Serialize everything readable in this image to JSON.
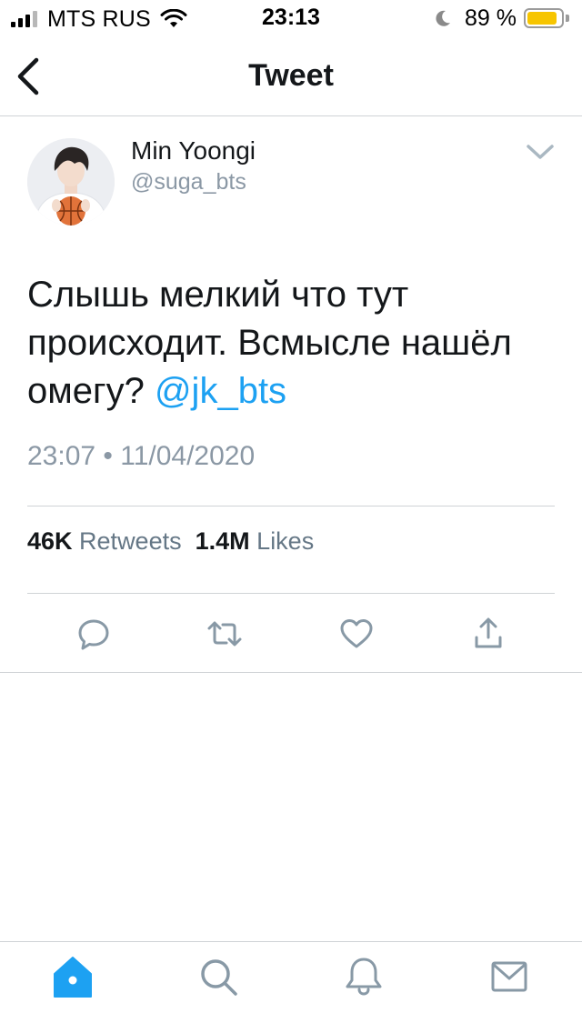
{
  "status_bar": {
    "carrier": "MTS RUS",
    "time": "23:13",
    "battery_percent": "89 %",
    "battery_level": 0.89,
    "battery_color": "#f7c500",
    "icons": [
      "signal-icon",
      "wifi-icon",
      "moon-icon",
      "battery-icon"
    ]
  },
  "nav": {
    "title": "Tweet",
    "back_icon": "chevron-left-icon"
  },
  "tweet": {
    "author": {
      "display_name": "Min Yoongi",
      "handle": "@suga_bts"
    },
    "menu_icon": "chevron-down-icon",
    "text": "Слышь мелкий что тут происходит. Всмысле нашёл омегу? ",
    "mention": "@jk_bts",
    "timestamp": "23:07 • 11/04/2020",
    "stats": {
      "retweets_count": "46K",
      "retweets_label": "Retweets",
      "likes_count": "1.4M",
      "likes_label": "Likes"
    },
    "actions": [
      "reply-icon",
      "retweet-icon",
      "like-icon",
      "share-icon"
    ]
  },
  "tab_bar": {
    "items": [
      "home-icon",
      "search-icon",
      "notifications-icon",
      "messages-icon"
    ],
    "active": "home-icon"
  },
  "colors": {
    "accent": "#1da1f2",
    "muted_text": "#8b98a5",
    "icon_gray": "#8899a6",
    "divider": "#cfd3d6",
    "text": "#14171a"
  }
}
